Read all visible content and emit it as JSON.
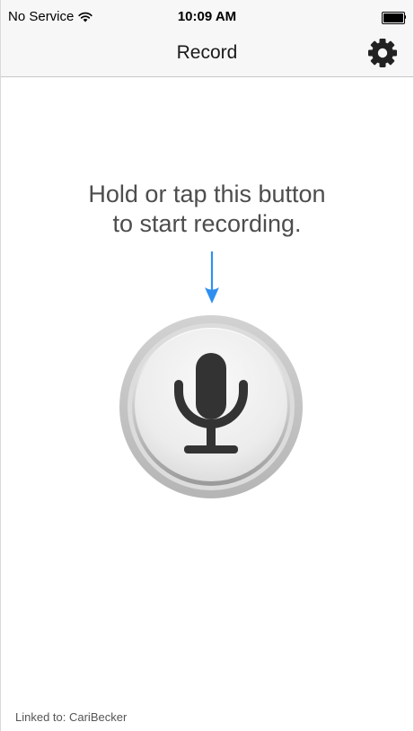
{
  "status_bar": {
    "carrier": "No Service",
    "time": "10:09 AM",
    "wifi_icon": "wifi-icon",
    "battery_icon": "battery-icon",
    "battery_level": 1.0
  },
  "nav": {
    "title": "Record",
    "settings_icon": "gear-icon"
  },
  "instructions": {
    "line1": "Hold or tap this button",
    "line2": "to start recording."
  },
  "arrow_icon": "arrow-down-icon",
  "record_button": {
    "icon": "microphone-icon"
  },
  "footer": {
    "linked_to": "Linked to: CariBecker"
  },
  "colors": {
    "accent": "#2f8ff0",
    "bar_background": "#f7f7f7",
    "text_secondary": "#4d4d4d",
    "mic_dark": "#333333"
  }
}
